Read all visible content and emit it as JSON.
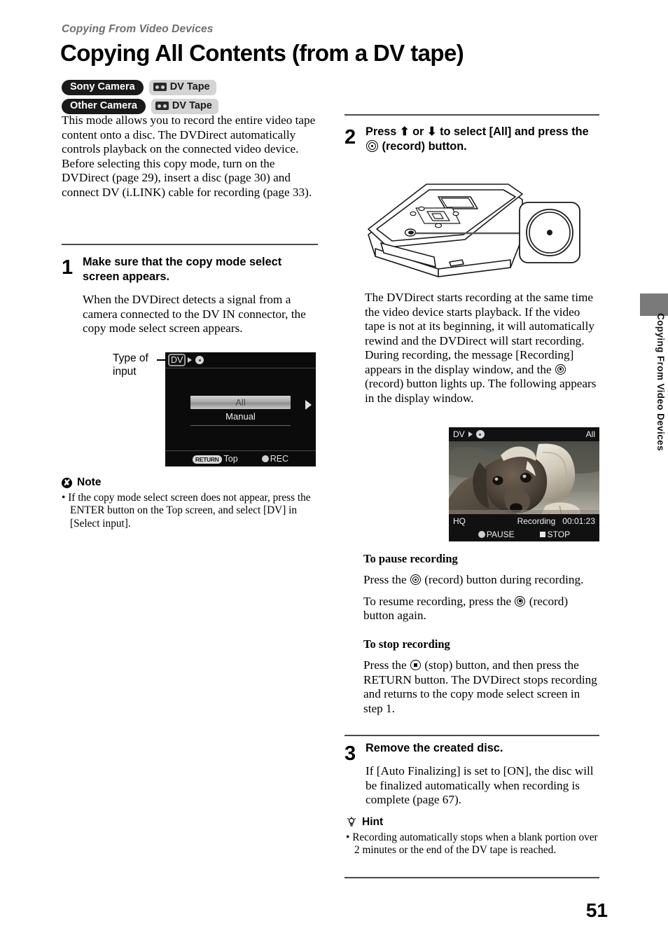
{
  "document": {
    "running_head": "Copying From Video Devices",
    "chapter_title": "Copying All Contents (from a DV tape)",
    "page_number": "51",
    "side_tab_text": "Copying From Video Devices"
  },
  "badges": [
    {
      "camera": "Sony Camera",
      "media": "DV Tape"
    },
    {
      "camera": "Other Camera",
      "media": "DV Tape"
    }
  ],
  "intro": {
    "paragraph1": "This mode allows you to record the entire video tape content onto a disc. The DVDirect automatically controls playback on the connected video device.",
    "paragraph2": "Before selecting this copy mode, turn on the DVDirect (page 29), insert a disc (page 30) and connect DV (i.LINK) cable for recording (page 33)."
  },
  "step1": {
    "number": "1",
    "heading": "Make sure that the copy mode select screen appears.",
    "body": "When the DVDirect detects a signal from a camera connected to the DV IN connector, the copy mode select screen appears.",
    "callout_label": "Type of input"
  },
  "menu_screen": {
    "input_label": "DV",
    "selected_item": "All",
    "second_item": "Manual",
    "return_key": "RETURN",
    "return_action": "Top",
    "rec_label": "REC"
  },
  "note": {
    "title": "Note",
    "mark": "✘",
    "bullet": "If the copy mode select screen does not appear, press the ENTER button on the Top screen, and select [DV] in [Select input]."
  },
  "step2": {
    "number": "2",
    "heading_part1": "Press ♦ or ♦ to select [All] and press the ",
    "heading_up": "⬆",
    "heading_down": "⬇",
    "heading_part2": " (record) button.",
    "body": "The DVDirect starts recording at the same time the video device starts playback. If the video tape is not at its beginning, it will automatically rewind and the DVDirect will start recording. During recording, the message [Recording] appears in the display window, and the ",
    "body_tail": " (record) button lights up. The following appears in the display window."
  },
  "rec_screen": {
    "input_label": "DV",
    "mode_label": "All",
    "quality_label": "HQ",
    "status_text": "Recording",
    "elapsed_time": "00:01:23",
    "pause_label": "PAUSE",
    "stop_label": "STOP"
  },
  "pause_section": {
    "heading": "To pause recording",
    "line1_pre": "Press the ",
    "line1_post": " (record) button during recording.",
    "line2_pre": "To resume recording, press the ",
    "line2_post": " (record) button again."
  },
  "stop_section": {
    "heading": "To stop recording",
    "line1_pre": "Press the ",
    "line1_post": " (stop) button, and then press the RETURN button. The DVDirect stops recording and returns to the copy mode select screen in step 1."
  },
  "step3": {
    "number": "3",
    "heading": "Remove the created disc.",
    "body": "If [Auto Finalizing] is set to [ON], the disc will be finalized automatically when recording is complete (page 67)."
  },
  "hint": {
    "title": "Hint",
    "bullet": "Recording automatically stops when a blank portion over 2 minutes or the end of the DV tape is reached."
  },
  "colors": {
    "running_head": "#6f6f6f",
    "rule": "#4a4a4a",
    "badge_dark": "#1a1a1a",
    "badge_light": "#d4d4d4",
    "side_tab": "#7a7a7a"
  }
}
